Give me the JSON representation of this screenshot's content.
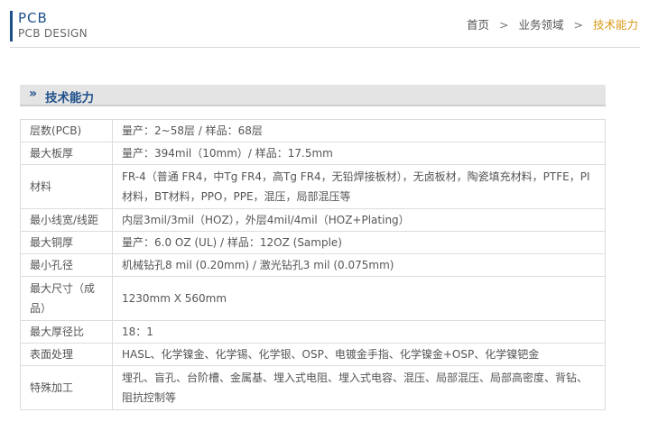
{
  "header": {
    "brand_title": "PCB",
    "brand_subtitle": "PCB DESIGN"
  },
  "breadcrumb": {
    "items": [
      "首页",
      "业务领域",
      "技术能力"
    ],
    "separator": ">"
  },
  "section": {
    "arrow": "»",
    "title": "技术能力"
  },
  "spec_table": {
    "rows": [
      {
        "label": "层数(PCB)",
        "value": "量产：2~58层 / 样品：68层"
      },
      {
        "label": "最大板厚",
        "value": "量产：394mil（10mm）/ 样品：17.5mm"
      },
      {
        "label": "材料",
        "value": "FR-4（普通 FR4，中Tg FR4，高Tg FR4，无铅焊接板材），无卤板材，陶瓷填充材料，PTFE，PI材料，BT材料，PPO，PPE，混压，局部混压等"
      },
      {
        "label": "最小线宽/线距",
        "value": "内层3mil/3mil（HOZ），外层4mil/4mil（HOZ+Plating）"
      },
      {
        "label": "最大铜厚",
        "value": "量产：6.0 OZ (UL) / 样品：12OZ (Sample)"
      },
      {
        "label": "最小孔径",
        "value": "机械钻孔8 mil (0.20mm) / 激光钻孔3 mil (0.075mm)"
      },
      {
        "label": "最大尺寸（成品）",
        "value": "1230mm X 560mm"
      },
      {
        "label": "最大厚径比",
        "value": "18：1"
      },
      {
        "label": "表面处理",
        "value": "HASL、化学镍金、化学锡、化学银、OSP、电镀金手指、化学镍金+OSP、化学镍钯金"
      },
      {
        "label": "特殊加工",
        "value": "埋孔、盲孔、台阶槽、金属基、埋入式电阻、埋入式电容、混压、局部混压、局部高密度、背钻、阻抗控制等"
      }
    ]
  },
  "colors": {
    "brand_blue": "#1e4f8a",
    "breadcrumb_current": "#d99a1b",
    "section_bar_bg": "#e4e4e4",
    "table_border": "#dcdcdc"
  }
}
